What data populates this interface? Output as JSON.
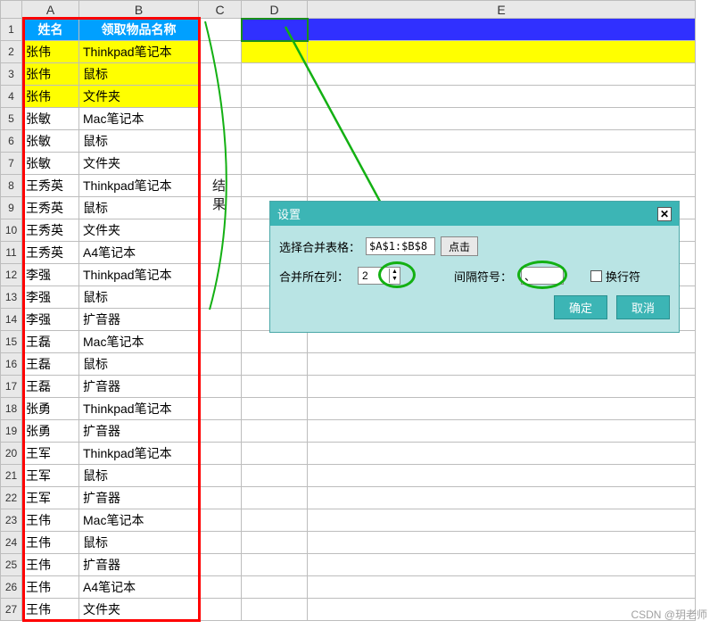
{
  "columns": [
    "A",
    "B",
    "C",
    "D",
    "E"
  ],
  "headerRow": {
    "a": "姓名",
    "b": "领取物品名称"
  },
  "rows": [
    {
      "a": "张伟",
      "b": "Thinkpad笔记本",
      "yellow": true
    },
    {
      "a": "张伟",
      "b": "鼠标",
      "yellow": true
    },
    {
      "a": "张伟",
      "b": "文件夹",
      "yellow": true
    },
    {
      "a": "张敏",
      "b": "Mac笔记本"
    },
    {
      "a": "张敏",
      "b": "鼠标"
    },
    {
      "a": "张敏",
      "b": "文件夹"
    },
    {
      "a": "王秀英",
      "b": "Thinkpad笔记本"
    },
    {
      "a": "王秀英",
      "b": "鼠标"
    },
    {
      "a": "王秀英",
      "b": "文件夹"
    },
    {
      "a": "王秀英",
      "b": "A4笔记本"
    },
    {
      "a": "李强",
      "b": "Thinkpad笔记本"
    },
    {
      "a": "李强",
      "b": "鼠标"
    },
    {
      "a": "李强",
      "b": "扩音器"
    },
    {
      "a": "王磊",
      "b": "Mac笔记本"
    },
    {
      "a": "王磊",
      "b": "鼠标"
    },
    {
      "a": "王磊",
      "b": "扩音器"
    },
    {
      "a": "张勇",
      "b": "Thinkpad笔记本"
    },
    {
      "a": "张勇",
      "b": "扩音器"
    },
    {
      "a": "王军",
      "b": "Thinkpad笔记本"
    },
    {
      "a": "王军",
      "b": "鼠标"
    },
    {
      "a": "王军",
      "b": "扩音器"
    },
    {
      "a": "王伟",
      "b": "Mac笔记本"
    },
    {
      "a": "王伟",
      "b": "鼠标"
    },
    {
      "a": "王伟",
      "b": "扩音器"
    },
    {
      "a": "王伟",
      "b": "A4笔记本"
    },
    {
      "a": "王伟",
      "b": "文件夹"
    }
  ],
  "annotText": "结果",
  "dialog": {
    "title": "设置",
    "label_range": "选择合并表格：",
    "value_range": "$A$1:$B$8",
    "btn_click": "点击",
    "label_col": "合并所在列：",
    "value_col": "2",
    "label_sep": "间隔符号：",
    "value_sep": "、",
    "label_wrap": "换行符",
    "btn_ok": "确定",
    "btn_cancel": "取消"
  },
  "watermark": "CSDN @玥老师"
}
